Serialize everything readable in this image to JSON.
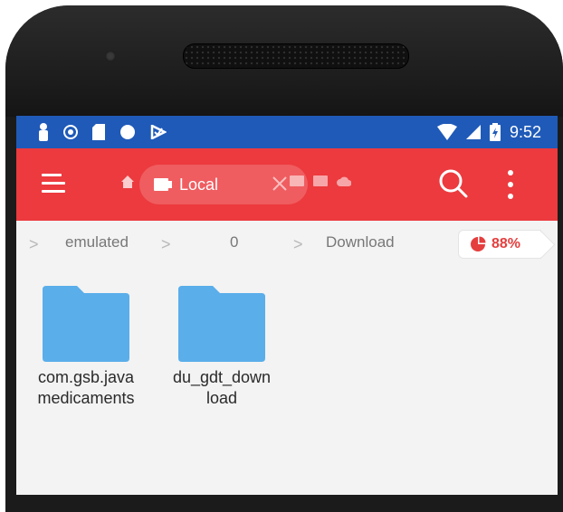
{
  "status_bar": {
    "time": "9:52",
    "icons_left": [
      "person-icon",
      "shield-icon",
      "sd-card-icon",
      "circle-icon",
      "checkmark-flag-icon"
    ],
    "icons_right": [
      "wifi-icon",
      "signal-icon",
      "battery-icon"
    ]
  },
  "toolbar": {
    "tab_label": "Local",
    "accent_color": "#ec3a3e",
    "icons": [
      "menu-icon",
      "home-icon",
      "close-icon",
      "folder-tab-icon",
      "tab-icon",
      "cloud-icon",
      "search-icon",
      "more-icon"
    ]
  },
  "breadcrumb": {
    "items": [
      "emulated",
      "0",
      "Download"
    ],
    "storage_percent": "88%"
  },
  "folders": [
    {
      "name_line1": "com.gsb.java",
      "name_line2": "medicaments"
    },
    {
      "name_line1": "du_gdt_down",
      "name_line2": "load"
    }
  ],
  "colors": {
    "status_bar": "#1f5ab8",
    "folder": "#5aaeea",
    "background": "#f3f3f3"
  }
}
